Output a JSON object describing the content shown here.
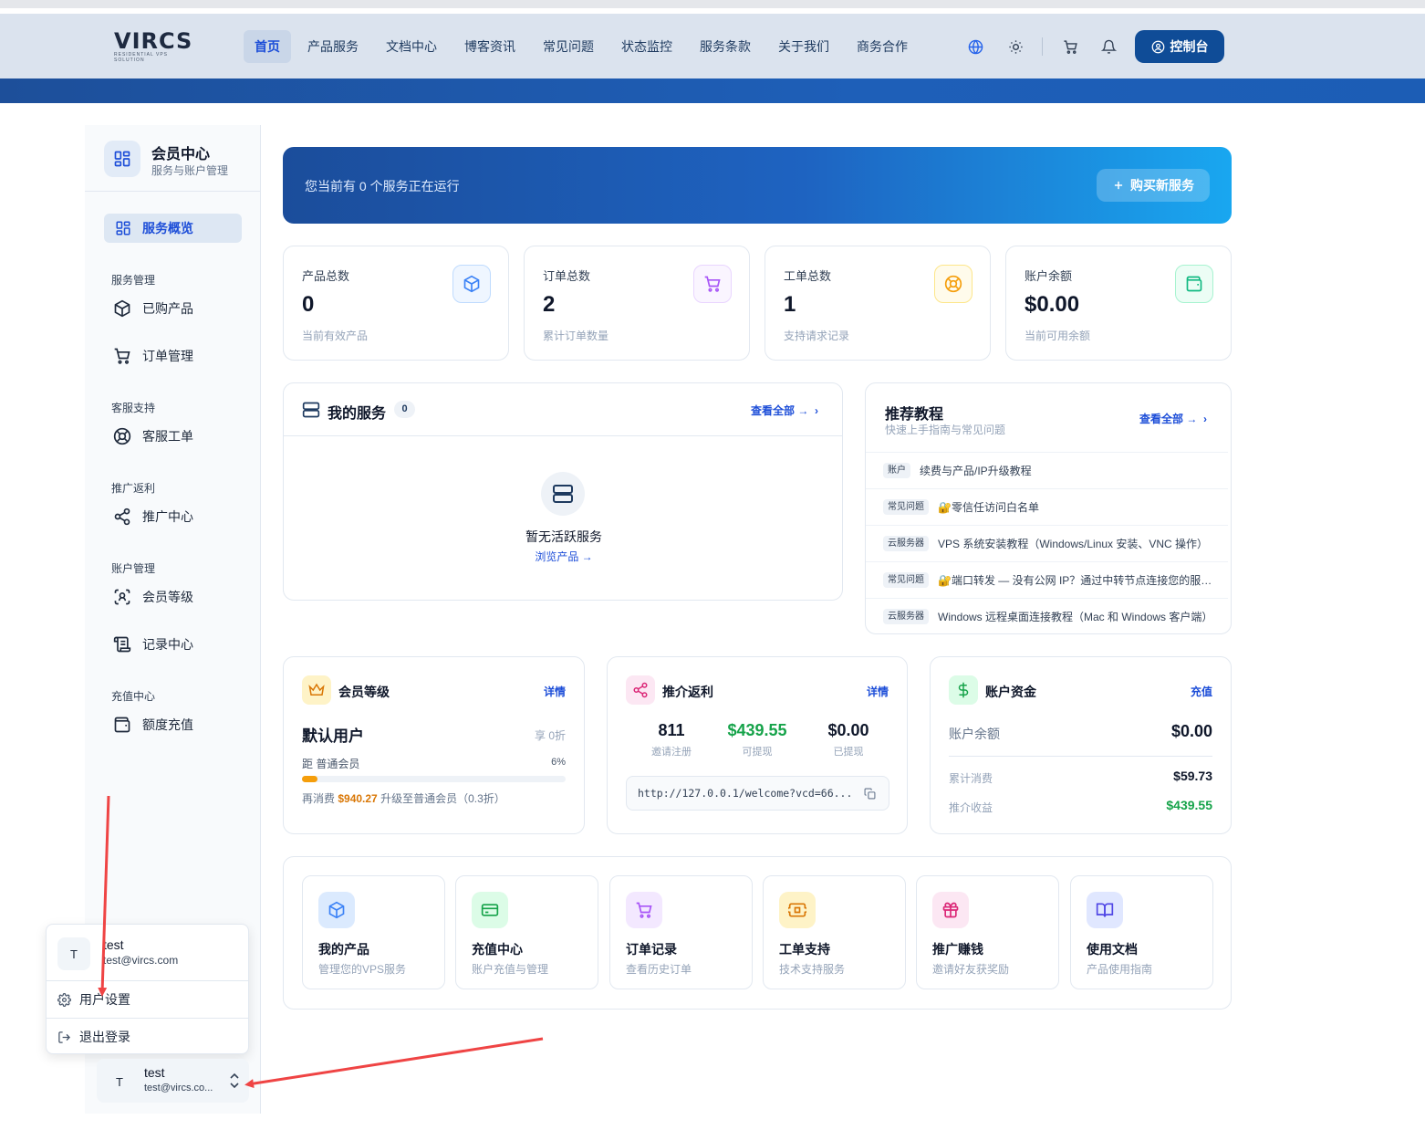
{
  "header": {
    "logo_text": "VIRCS",
    "logo_sub": "RESIDENTIAL VPS SOLUTION",
    "nav": [
      "首页",
      "产品服务",
      "文档中心",
      "博客资讯",
      "常见问题",
      "状态监控",
      "服务条款",
      "关于我们",
      "商务合作"
    ],
    "console_label": "控制台",
    "accent": "#0f4c97"
  },
  "sidebar": {
    "title": "会员中心",
    "subtitle": "服务与账户管理",
    "active_item": "服务概览",
    "groups": [
      {
        "label": "服务管理",
        "items": [
          "已购产品",
          "订单管理"
        ]
      },
      {
        "label": "客服支持",
        "items": [
          "客服工单"
        ]
      },
      {
        "label": "推广返利",
        "items": [
          "推广中心"
        ]
      },
      {
        "label": "账户管理",
        "items": [
          "会员等级",
          "记录中心"
        ]
      },
      {
        "label": "充值中心",
        "items": [
          "额度充值"
        ]
      }
    ]
  },
  "user_menu": {
    "avatar": "T",
    "name": "test",
    "email": "test@vircs.com",
    "settings": "用户设置",
    "logout": "退出登录"
  },
  "user_card": {
    "avatar": "T",
    "name": "test",
    "email": "test@vircs.co..."
  },
  "hero": {
    "text": "您当前有 0 个服务正在运行",
    "button": "购买新服务"
  },
  "stats": [
    {
      "label": "产品总数",
      "value": "0",
      "sub": "当前有效产品",
      "icon": "cube-icon",
      "color": "#3b82f6"
    },
    {
      "label": "订单总数",
      "value": "2",
      "sub": "累计订单数量",
      "icon": "cart-icon",
      "color": "#a855f7"
    },
    {
      "label": "工单总数",
      "value": "1",
      "sub": "支持请求记录",
      "icon": "lifebuoy-icon",
      "color": "#f59e0b"
    },
    {
      "label": "账户余额",
      "value": "$0.00",
      "sub": "当前可用余额",
      "icon": "wallet-icon",
      "color": "#10b981"
    }
  ],
  "my_services": {
    "title": "我的服务",
    "count": "0",
    "view_all": "查看全部 →",
    "empty_title": "暂无活跃服务",
    "empty_link": "浏览产品 →"
  },
  "tutorials": {
    "title": "推荐教程",
    "subtitle": "快速上手指南与常见问题",
    "view_all": "查看全部 →",
    "items": [
      {
        "tag": "账户",
        "title": "续费与产品/IP升级教程"
      },
      {
        "tag": "常见问题",
        "title": "🔐零信任访问白名单"
      },
      {
        "tag": "云服务器",
        "title": "VPS 系统安装教程（Windows/Linux 安装、VNC 操作）"
      },
      {
        "tag": "常见问题",
        "title": "🔐端口转发 — 没有公网 IP？通过中转节点连接您的服务..."
      },
      {
        "tag": "云服务器",
        "title": "Windows 远程桌面连接教程（Mac 和 Windows 客户端）"
      }
    ]
  },
  "membership": {
    "title": "会员等级",
    "link": "详情",
    "level": "默认用户",
    "discount": "享 0折",
    "progress_label": "距 普通会员",
    "progress_pct": "6%",
    "progress_value": 0.06,
    "note_prefix": "再消费 ",
    "note_amount": "$940.27",
    "note_suffix": " 升级至普通会员（0.3折）"
  },
  "referral": {
    "title": "推介返利",
    "link": "详情",
    "stats": [
      {
        "value": "811",
        "label": "邀请注册",
        "color": "#0f172a"
      },
      {
        "value": "$439.55",
        "label": "可提现",
        "color": "#16a34a"
      },
      {
        "value": "$0.00",
        "label": "已提现",
        "color": "#0f172a"
      }
    ],
    "url": "http://127.0.0.1/welcome?vcd=66..."
  },
  "funds": {
    "title": "账户资金",
    "link": "充值",
    "balance_label": "账户余额",
    "balance": "$0.00",
    "spent_label": "累计消费",
    "spent": "$59.73",
    "income_label": "推介收益",
    "income": "$439.55"
  },
  "quick_links": [
    {
      "title": "我的产品",
      "sub": "管理您的VPS服务",
      "icon": "cube-icon",
      "bg": "#dbeafe",
      "color": "#3b82f6"
    },
    {
      "title": "充值中心",
      "sub": "账户充值与管理",
      "icon": "card-icon",
      "bg": "#dcfce7",
      "color": "#16a34a"
    },
    {
      "title": "订单记录",
      "sub": "查看历史订单",
      "icon": "cart-icon",
      "bg": "#f3e8ff",
      "color": "#a855f7"
    },
    {
      "title": "工单支持",
      "sub": "技术支持服务",
      "icon": "ticket-icon",
      "bg": "#fef3c7",
      "color": "#d97706"
    },
    {
      "title": "推广赚钱",
      "sub": "邀请好友获奖励",
      "icon": "gift-icon",
      "bg": "#fce7f3",
      "color": "#db2777"
    },
    {
      "title": "使用文档",
      "sub": "产品使用指南",
      "icon": "book-icon",
      "bg": "#e0e7ff",
      "color": "#4f46e5"
    }
  ]
}
